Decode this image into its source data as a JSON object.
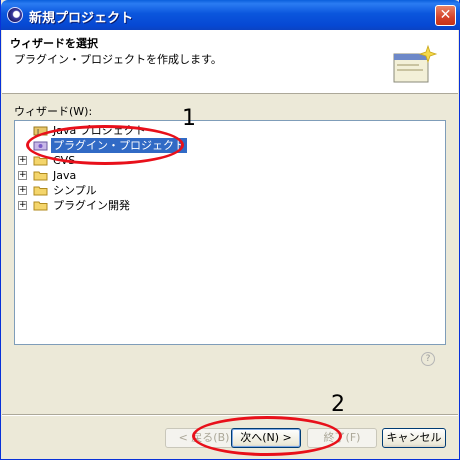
{
  "window": {
    "title": "新規プロジェクト",
    "close_glyph": "✕"
  },
  "header": {
    "title": "ウィザードを選択",
    "description": "プラグイン・プロジェクトを作成します。"
  },
  "wizard_section": {
    "label": "ウィザード(W):"
  },
  "tree": {
    "items": [
      {
        "label": "Java プロジェクト",
        "icon": "java-project-icon",
        "expander": ""
      },
      {
        "label": "プラグイン・プロジェクト",
        "icon": "plugin-project-icon",
        "expander": "",
        "selected": true
      },
      {
        "label": "CVS",
        "icon": "folder-icon",
        "expander": "+"
      },
      {
        "label": "Java",
        "icon": "folder-icon",
        "expander": "+"
      },
      {
        "label": "シンプル",
        "icon": "folder-icon",
        "expander": "+"
      },
      {
        "label": "プラグイン開発",
        "icon": "folder-icon",
        "expander": "+"
      }
    ]
  },
  "help": {
    "glyph": "?"
  },
  "buttons": {
    "back": "< 戻る(B)",
    "next": "次へ(N) >",
    "finish": "終了(F)",
    "cancel": "キャンセル"
  },
  "annotations": {
    "marker_1": "1",
    "marker_2": "2",
    "color": "#e8101a"
  }
}
